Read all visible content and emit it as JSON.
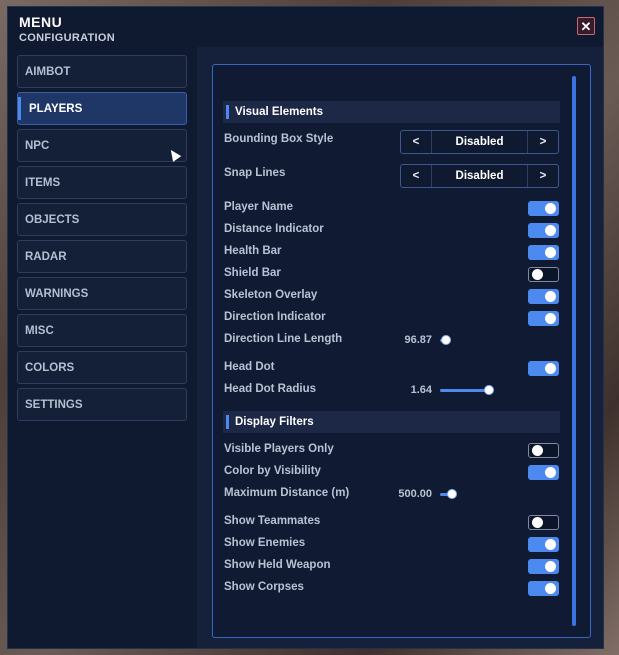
{
  "header": {
    "title": "MENU",
    "subtitle": "CONFIGURATION",
    "close_label": "✕"
  },
  "nav": {
    "items": [
      {
        "label": "AIMBOT"
      },
      {
        "label": "PLAYERS",
        "active": true
      },
      {
        "label": "NPC"
      },
      {
        "label": "ITEMS"
      },
      {
        "label": "OBJECTS"
      },
      {
        "label": "RADAR"
      },
      {
        "label": "WARNINGS"
      },
      {
        "label": "MISC"
      },
      {
        "label": "COLORS"
      },
      {
        "label": "SETTINGS"
      }
    ]
  },
  "panel": {
    "visual_section": "Visual Elements",
    "bounding_box": {
      "label": "Bounding Box Style",
      "value": "Disabled",
      "prev": "<",
      "next": ">"
    },
    "snap_lines": {
      "label": "Snap Lines",
      "value": "Disabled",
      "prev": "<",
      "next": ">"
    },
    "player_name": {
      "label": "Player Name",
      "on": true
    },
    "distance_indicator": {
      "label": "Distance Indicator",
      "on": true
    },
    "health_bar": {
      "label": "Health Bar",
      "on": true
    },
    "shield_bar": {
      "label": "Shield Bar",
      "on": false
    },
    "skeleton_overlay": {
      "label": "Skeleton Overlay",
      "on": true
    },
    "direction_indicator": {
      "label": "Direction Indicator",
      "on": true
    },
    "direction_line_length": {
      "label": "Direction Line Length",
      "value": "96.87",
      "fraction": 0.1
    },
    "head_dot": {
      "label": "Head Dot",
      "on": true
    },
    "head_dot_radius": {
      "label": "Head Dot Radius",
      "value": "1.64",
      "fraction": 0.82
    },
    "filters_section": "Display Filters",
    "visible_players_only": {
      "label": "Visible Players Only",
      "on": false
    },
    "color_by_visibility": {
      "label": "Color by Visibility",
      "on": true
    },
    "maximum_distance": {
      "label": "Maximum Distance (m)",
      "value": "500.00",
      "fraction": 0.2
    },
    "show_teammates": {
      "label": "Show Teammates",
      "on": false
    },
    "show_enemies": {
      "label": "Show Enemies",
      "on": true
    },
    "show_held_weapon": {
      "label": "Show Held Weapon",
      "on": true
    },
    "show_corpses": {
      "label": "Show Corpses",
      "on": true
    }
  },
  "colors": {
    "accent": "#4d8af0",
    "window_bg": "#0f1a30",
    "close_border": "#c06a78"
  }
}
